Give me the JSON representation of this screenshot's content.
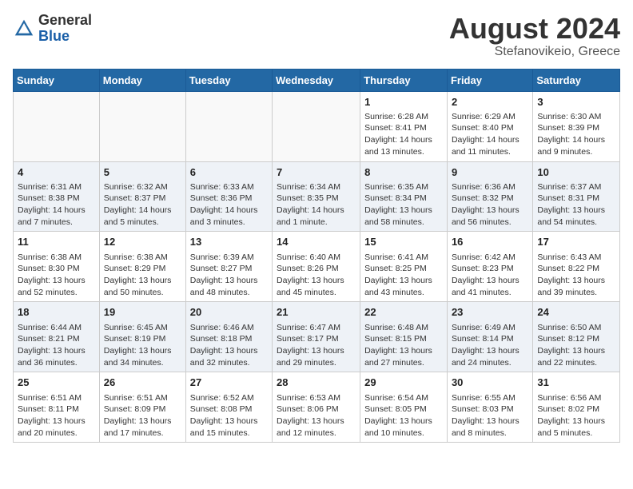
{
  "header": {
    "logo_general": "General",
    "logo_blue": "Blue",
    "month_year": "August 2024",
    "location": "Stefanovikeio, Greece"
  },
  "weekdays": [
    "Sunday",
    "Monday",
    "Tuesday",
    "Wednesday",
    "Thursday",
    "Friday",
    "Saturday"
  ],
  "weeks": [
    [
      {
        "day": "",
        "info": ""
      },
      {
        "day": "",
        "info": ""
      },
      {
        "day": "",
        "info": ""
      },
      {
        "day": "",
        "info": ""
      },
      {
        "day": "1",
        "info": "Sunrise: 6:28 AM\nSunset: 8:41 PM\nDaylight: 14 hours\nand 13 minutes."
      },
      {
        "day": "2",
        "info": "Sunrise: 6:29 AM\nSunset: 8:40 PM\nDaylight: 14 hours\nand 11 minutes."
      },
      {
        "day": "3",
        "info": "Sunrise: 6:30 AM\nSunset: 8:39 PM\nDaylight: 14 hours\nand 9 minutes."
      }
    ],
    [
      {
        "day": "4",
        "info": "Sunrise: 6:31 AM\nSunset: 8:38 PM\nDaylight: 14 hours\nand 7 minutes."
      },
      {
        "day": "5",
        "info": "Sunrise: 6:32 AM\nSunset: 8:37 PM\nDaylight: 14 hours\nand 5 minutes."
      },
      {
        "day": "6",
        "info": "Sunrise: 6:33 AM\nSunset: 8:36 PM\nDaylight: 14 hours\nand 3 minutes."
      },
      {
        "day": "7",
        "info": "Sunrise: 6:34 AM\nSunset: 8:35 PM\nDaylight: 14 hours\nand 1 minute."
      },
      {
        "day": "8",
        "info": "Sunrise: 6:35 AM\nSunset: 8:34 PM\nDaylight: 13 hours\nand 58 minutes."
      },
      {
        "day": "9",
        "info": "Sunrise: 6:36 AM\nSunset: 8:32 PM\nDaylight: 13 hours\nand 56 minutes."
      },
      {
        "day": "10",
        "info": "Sunrise: 6:37 AM\nSunset: 8:31 PM\nDaylight: 13 hours\nand 54 minutes."
      }
    ],
    [
      {
        "day": "11",
        "info": "Sunrise: 6:38 AM\nSunset: 8:30 PM\nDaylight: 13 hours\nand 52 minutes."
      },
      {
        "day": "12",
        "info": "Sunrise: 6:38 AM\nSunset: 8:29 PM\nDaylight: 13 hours\nand 50 minutes."
      },
      {
        "day": "13",
        "info": "Sunrise: 6:39 AM\nSunset: 8:27 PM\nDaylight: 13 hours\nand 48 minutes."
      },
      {
        "day": "14",
        "info": "Sunrise: 6:40 AM\nSunset: 8:26 PM\nDaylight: 13 hours\nand 45 minutes."
      },
      {
        "day": "15",
        "info": "Sunrise: 6:41 AM\nSunset: 8:25 PM\nDaylight: 13 hours\nand 43 minutes."
      },
      {
        "day": "16",
        "info": "Sunrise: 6:42 AM\nSunset: 8:23 PM\nDaylight: 13 hours\nand 41 minutes."
      },
      {
        "day": "17",
        "info": "Sunrise: 6:43 AM\nSunset: 8:22 PM\nDaylight: 13 hours\nand 39 minutes."
      }
    ],
    [
      {
        "day": "18",
        "info": "Sunrise: 6:44 AM\nSunset: 8:21 PM\nDaylight: 13 hours\nand 36 minutes."
      },
      {
        "day": "19",
        "info": "Sunrise: 6:45 AM\nSunset: 8:19 PM\nDaylight: 13 hours\nand 34 minutes."
      },
      {
        "day": "20",
        "info": "Sunrise: 6:46 AM\nSunset: 8:18 PM\nDaylight: 13 hours\nand 32 minutes."
      },
      {
        "day": "21",
        "info": "Sunrise: 6:47 AM\nSunset: 8:17 PM\nDaylight: 13 hours\nand 29 minutes."
      },
      {
        "day": "22",
        "info": "Sunrise: 6:48 AM\nSunset: 8:15 PM\nDaylight: 13 hours\nand 27 minutes."
      },
      {
        "day": "23",
        "info": "Sunrise: 6:49 AM\nSunset: 8:14 PM\nDaylight: 13 hours\nand 24 minutes."
      },
      {
        "day": "24",
        "info": "Sunrise: 6:50 AM\nSunset: 8:12 PM\nDaylight: 13 hours\nand 22 minutes."
      }
    ],
    [
      {
        "day": "25",
        "info": "Sunrise: 6:51 AM\nSunset: 8:11 PM\nDaylight: 13 hours\nand 20 minutes."
      },
      {
        "day": "26",
        "info": "Sunrise: 6:51 AM\nSunset: 8:09 PM\nDaylight: 13 hours\nand 17 minutes."
      },
      {
        "day": "27",
        "info": "Sunrise: 6:52 AM\nSunset: 8:08 PM\nDaylight: 13 hours\nand 15 minutes."
      },
      {
        "day": "28",
        "info": "Sunrise: 6:53 AM\nSunset: 8:06 PM\nDaylight: 13 hours\nand 12 minutes."
      },
      {
        "day": "29",
        "info": "Sunrise: 6:54 AM\nSunset: 8:05 PM\nDaylight: 13 hours\nand 10 minutes."
      },
      {
        "day": "30",
        "info": "Sunrise: 6:55 AM\nSunset: 8:03 PM\nDaylight: 13 hours\nand 8 minutes."
      },
      {
        "day": "31",
        "info": "Sunrise: 6:56 AM\nSunset: 8:02 PM\nDaylight: 13 hours\nand 5 minutes."
      }
    ]
  ]
}
